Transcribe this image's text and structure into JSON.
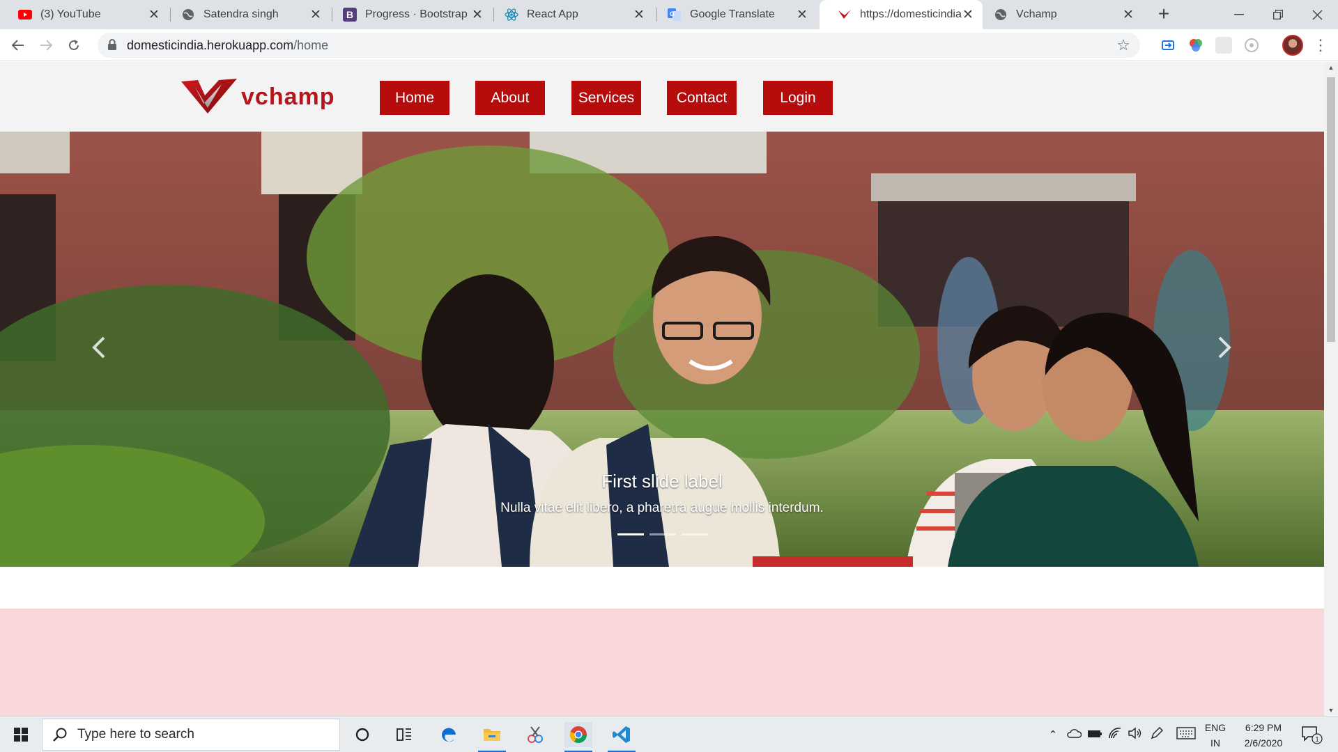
{
  "browser": {
    "tabs": [
      {
        "title": "(3) YouTube",
        "icon": "youtube-icon",
        "active": false
      },
      {
        "title": "Satendra singh",
        "icon": "globe-icon",
        "active": false
      },
      {
        "title": "Progress · Bootstrap",
        "icon": "bootstrap-icon",
        "active": false
      },
      {
        "title": "React App",
        "icon": "react-icon",
        "active": false
      },
      {
        "title": "Google Translate",
        "icon": "translate-icon",
        "active": false
      },
      {
        "title": "https://domesticindia.h",
        "icon": "vchamp-favicon",
        "active": true
      },
      {
        "title": "Vchamp",
        "icon": "globe-icon",
        "active": false
      }
    ],
    "new_tab_label": "+",
    "url_host": "domesticindia.herokuapp.com",
    "url_path": "/home"
  },
  "site": {
    "logo_text": "vchamp",
    "nav": [
      {
        "label": "Home"
      },
      {
        "label": "About"
      },
      {
        "label": "Services"
      },
      {
        "label": "Contact"
      },
      {
        "label": "Login"
      }
    ],
    "carousel": {
      "caption_title": "First slide label",
      "caption_text": "Nulla vitae elit libero, a pharetra augue mollis interdum.",
      "slide_count": 3,
      "active_slide": 1
    },
    "accent_color": "#b70c0c",
    "band_color": "#f8d7da"
  },
  "taskbar": {
    "search_placeholder": "Type here to search",
    "lang_line1": "ENG",
    "lang_line2": "IN",
    "time": "6:29 PM",
    "date": "2/6/2020",
    "notification_count": "1"
  }
}
